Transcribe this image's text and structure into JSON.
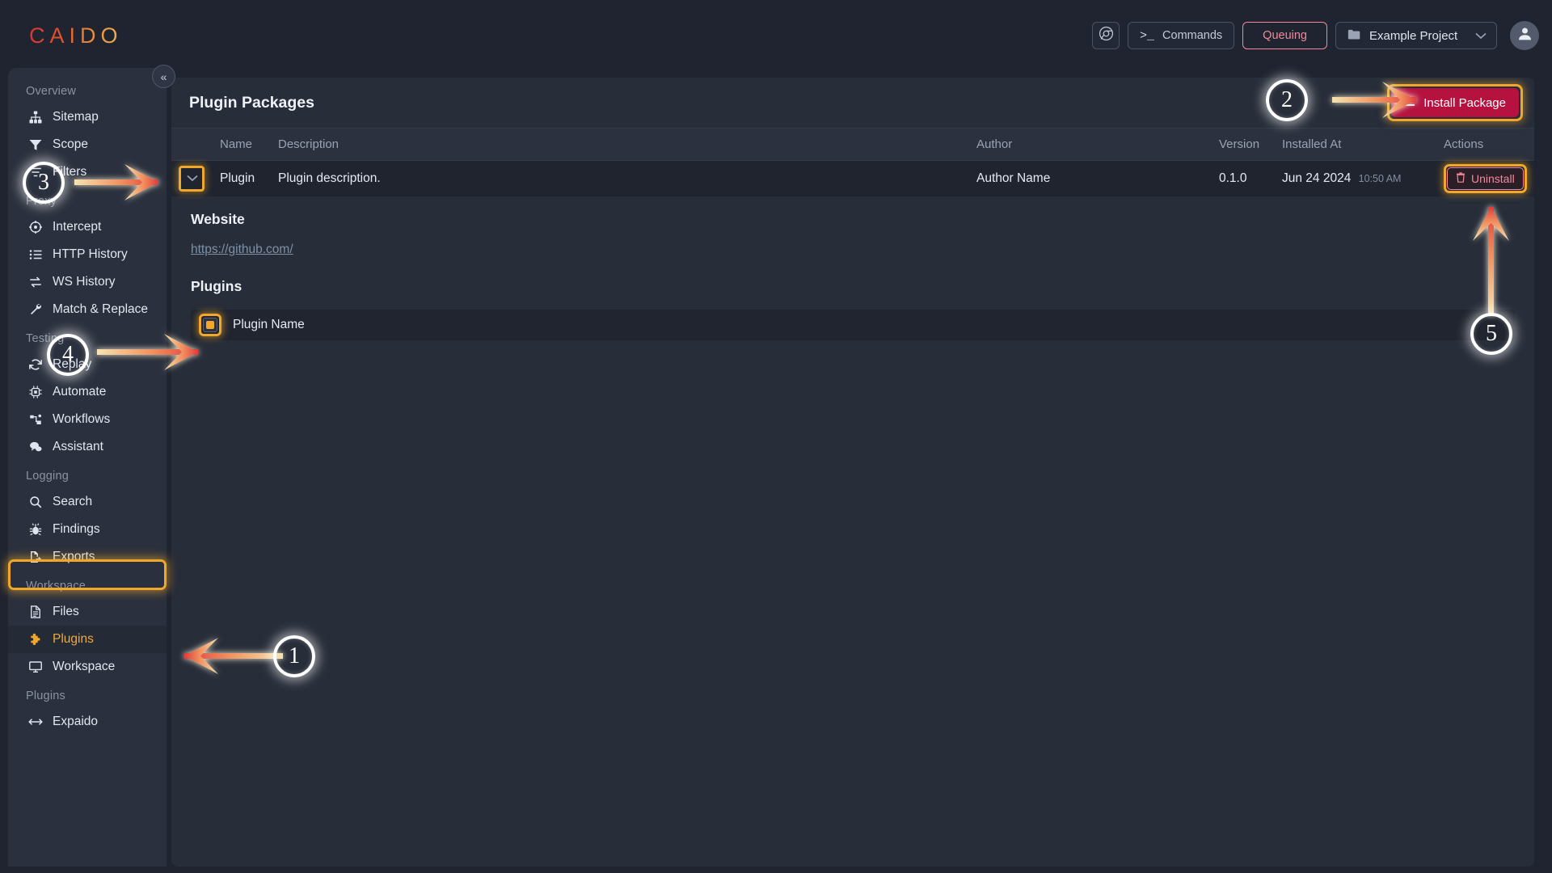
{
  "app": {
    "logo": "CAIDO",
    "accent_orange": "#f0a72a",
    "accent_red": "#b5123f",
    "accent_pink": "#f4889c",
    "bg": "#1f2430"
  },
  "topbar": {
    "browser_icon": "chrome-icon",
    "commands_label": "Commands",
    "commands_prompt": ">_",
    "queuing_label": "Queuing",
    "project_label": "Example Project",
    "project_icon": "folder-icon",
    "chevron": "⌄",
    "avatar_icon": "user-icon"
  },
  "sidebar": {
    "collapse_icon": "«",
    "groups": [
      {
        "label": "Overview",
        "items": [
          {
            "label": "Sitemap",
            "icon": "sitemap-icon"
          },
          {
            "label": "Scope",
            "icon": "filter-funnel-icon"
          },
          {
            "label": "Filters",
            "icon": "filters-icon"
          }
        ]
      },
      {
        "label": "Proxy",
        "items": [
          {
            "label": "Intercept",
            "icon": "crosshair-icon"
          },
          {
            "label": "HTTP History",
            "icon": "list-icon"
          },
          {
            "label": "WS History",
            "icon": "exchange-arrows-icon"
          },
          {
            "label": "Match & Replace",
            "icon": "wrench-icon"
          }
        ]
      },
      {
        "label": "Testing",
        "items": [
          {
            "label": "Replay",
            "icon": "refresh-icon"
          },
          {
            "label": "Automate",
            "icon": "chip-icon"
          },
          {
            "label": "Workflows",
            "icon": "workflow-icon"
          },
          {
            "label": "Assistant",
            "icon": "chat-bubbles-icon"
          }
        ]
      },
      {
        "label": "Logging",
        "items": [
          {
            "label": "Search",
            "icon": "magnifier-icon"
          },
          {
            "label": "Findings",
            "icon": "bug-icon"
          },
          {
            "label": "Exports",
            "icon": "export-icon"
          }
        ]
      },
      {
        "label": "Workspace",
        "items": [
          {
            "label": "Files",
            "icon": "file-icon"
          },
          {
            "label": "Plugins",
            "icon": "puzzle-piece-icon",
            "active": true
          },
          {
            "label": "Workspace",
            "icon": "monitor-icon"
          }
        ]
      },
      {
        "label": "Plugins",
        "items": [
          {
            "label": "Expaido",
            "icon": "arrows-horizontal-icon"
          }
        ]
      }
    ]
  },
  "main": {
    "title": "Plugin Packages",
    "install_label": "Install Package",
    "install_icon": "upload-icon",
    "table": {
      "columns": [
        "",
        "Name",
        "Description",
        "Author",
        "Version",
        "Installed At",
        "Actions"
      ],
      "rows": [
        {
          "expand_icon": "chevron-down-icon",
          "name": "Plugin",
          "description": "Plugin description.",
          "author": "Author Name",
          "version": "0.1.0",
          "installed_date": "Jun 24 2024",
          "installed_time": "10:50 AM",
          "action_label": "Uninstall",
          "action_icon": "trash-icon"
        }
      ]
    },
    "detail": {
      "website_heading": "Website",
      "website_url": "https://github.com/",
      "plugins_heading": "Plugins",
      "plugin_items": [
        {
          "name": "Plugin Name",
          "checked": true
        }
      ]
    }
  },
  "callouts": [
    {
      "number": "1"
    },
    {
      "number": "2"
    },
    {
      "number": "3"
    },
    {
      "number": "4"
    },
    {
      "number": "5"
    }
  ]
}
